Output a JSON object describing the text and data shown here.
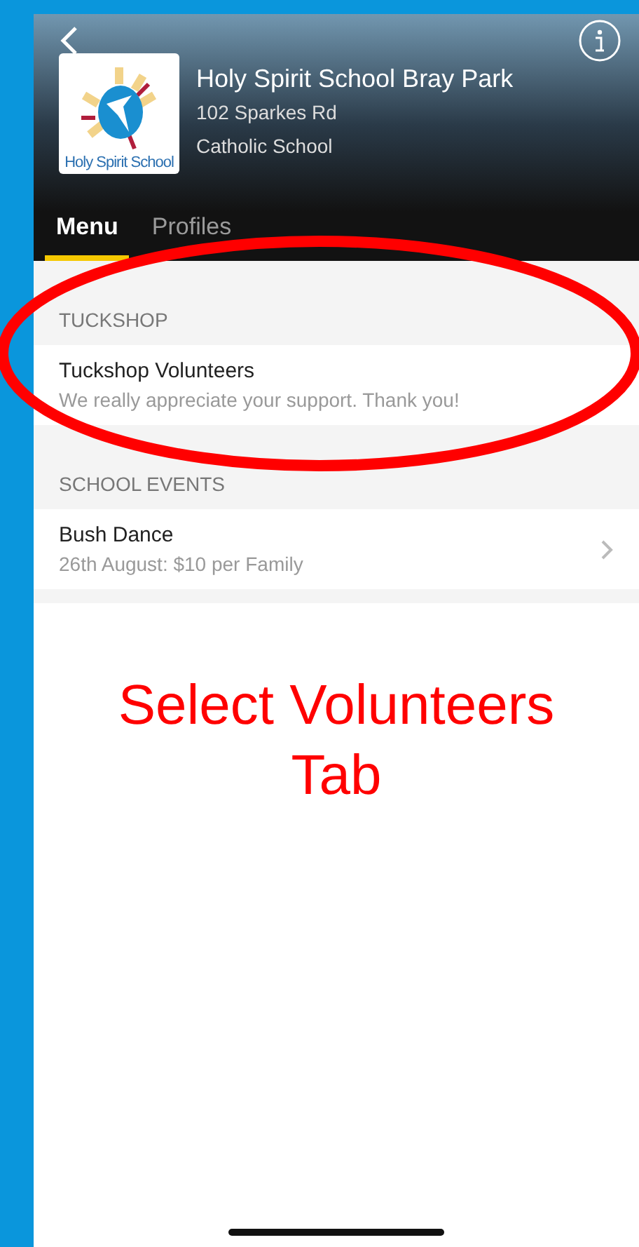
{
  "header": {
    "school_name": "Holy Spirit School Bray Park",
    "address": "102 Sparkes Rd",
    "category": "Catholic School",
    "logo_caption": "Holy Spirit School"
  },
  "tabs": [
    {
      "label": "Menu",
      "selected": true
    },
    {
      "label": "Profiles",
      "selected": false
    }
  ],
  "sections": [
    {
      "title": "TUCKSHOP",
      "items": [
        {
          "title": "Tuckshop Volunteers",
          "subtitle": "We really appreciate your support. Thank you!",
          "highlighted": true
        }
      ]
    },
    {
      "title": "SCHOOL EVENTS",
      "items": [
        {
          "title": "Bush Dance",
          "subtitle": "26th August: $10 per Family",
          "highlighted": false
        }
      ]
    }
  ],
  "annotation": {
    "text": "Select Volunteers Tab"
  }
}
